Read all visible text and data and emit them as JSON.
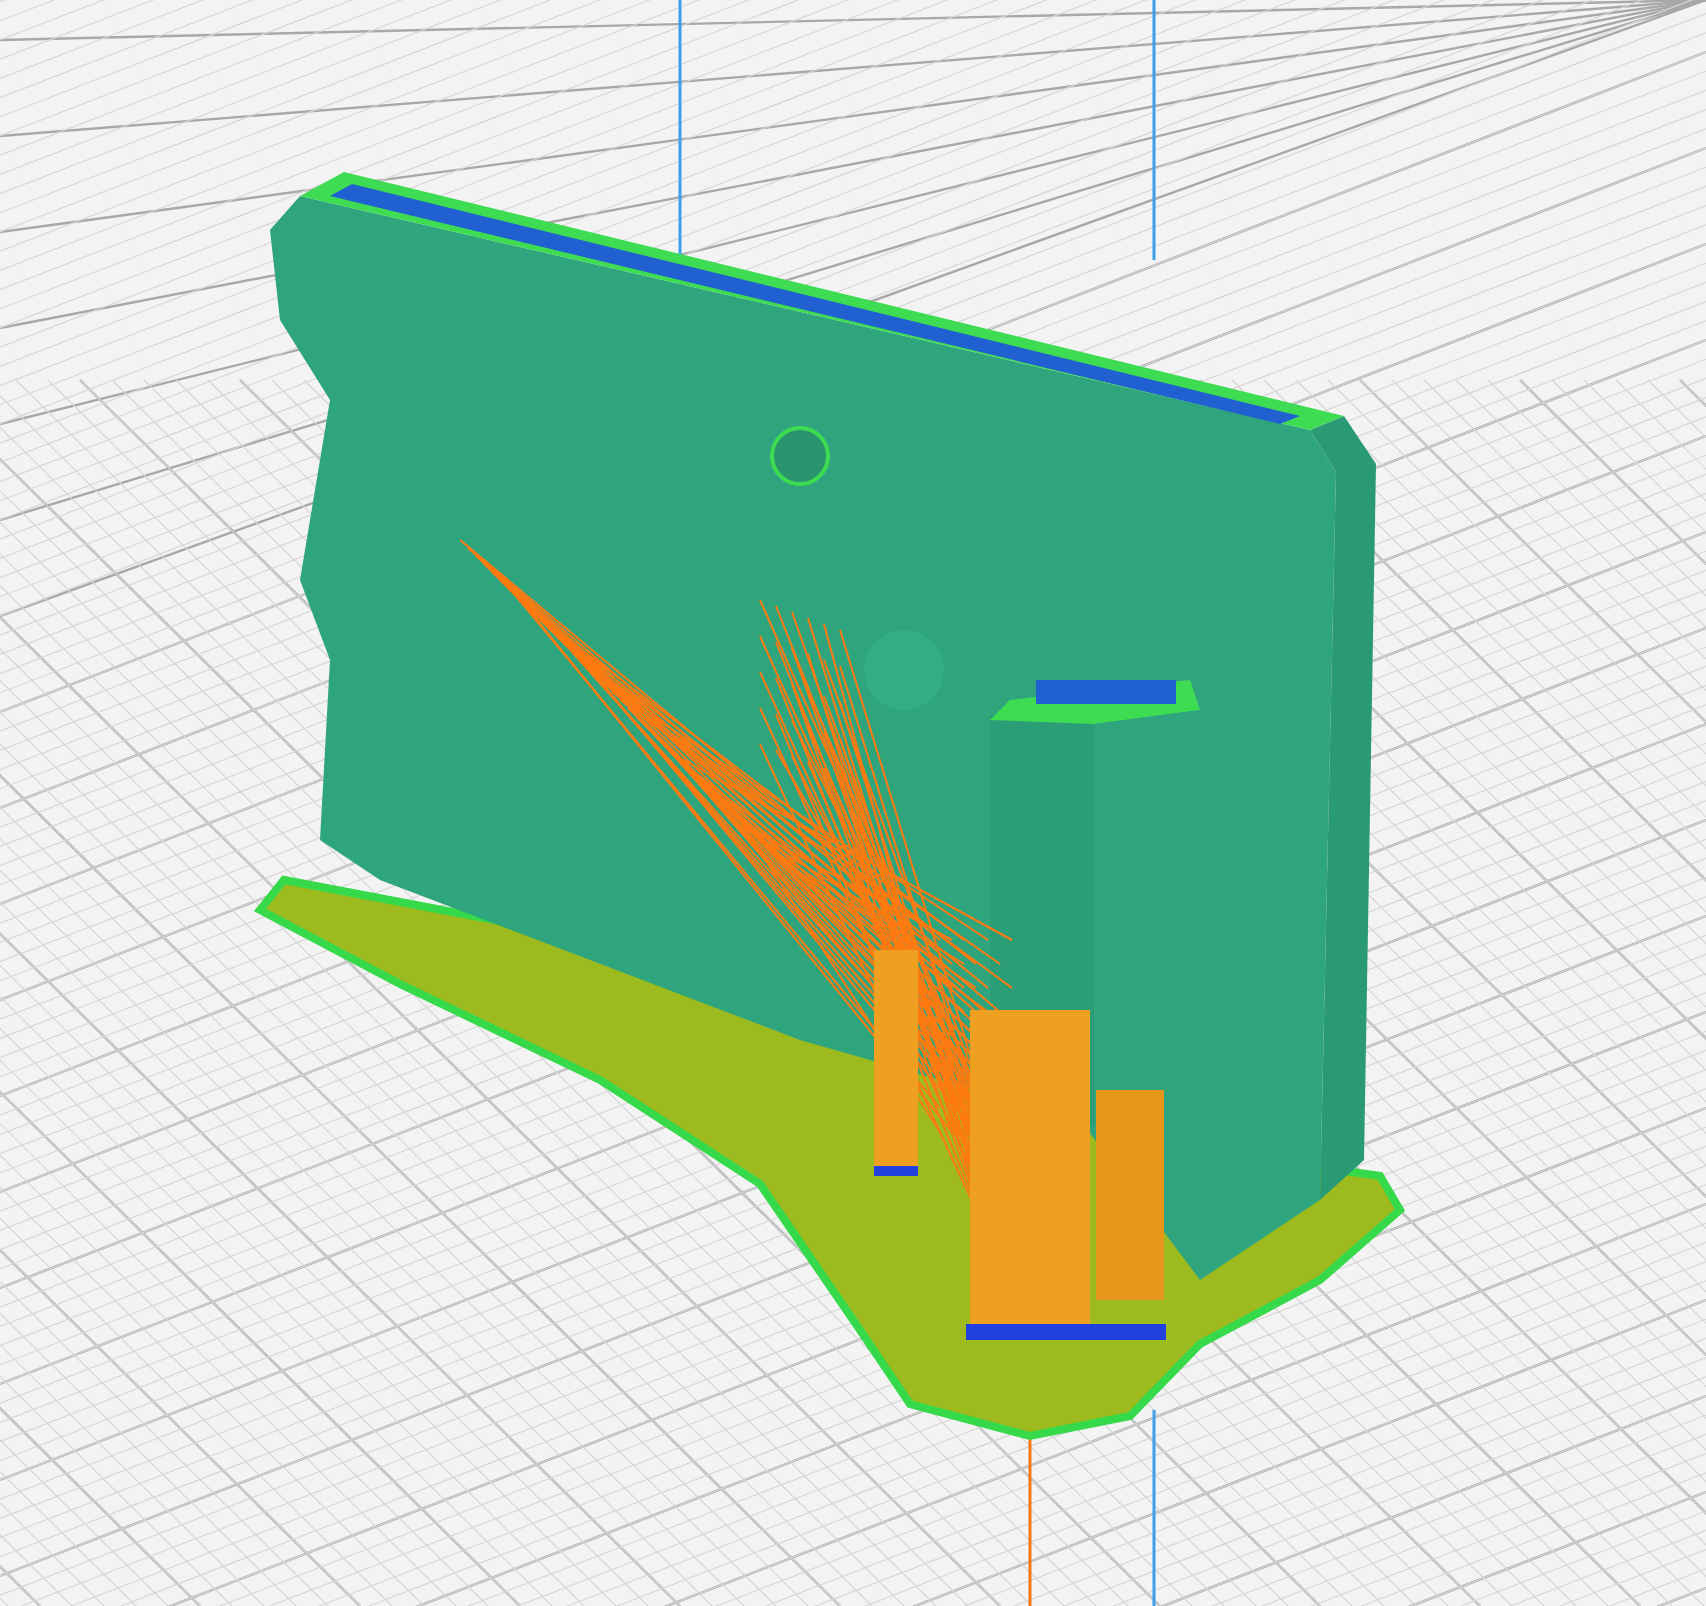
{
  "build_plate": {
    "grid": true
  }
}
